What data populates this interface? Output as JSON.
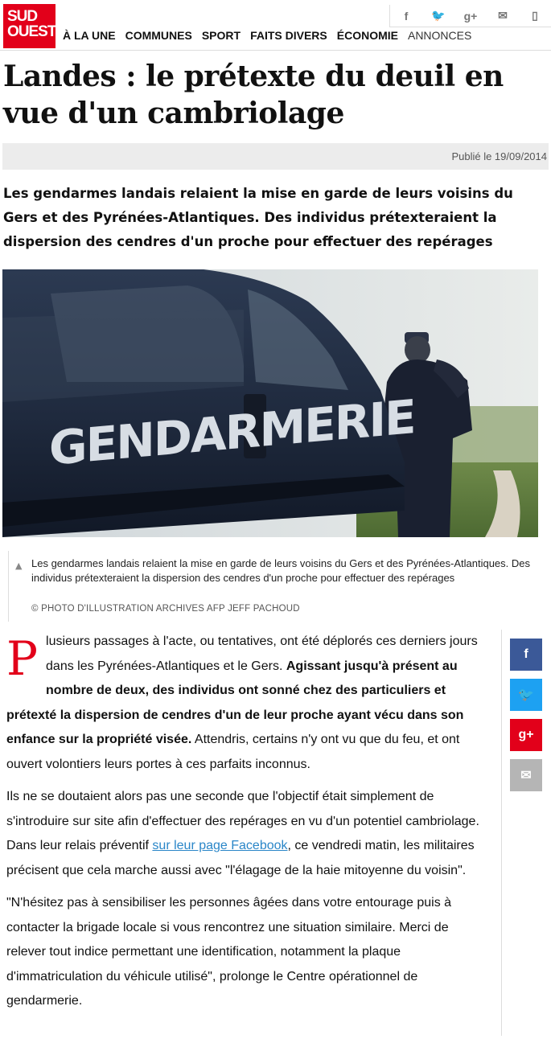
{
  "logo": {
    "line1": "SUD",
    "line2": "OUEST"
  },
  "share_top": [
    {
      "icon": "facebook-icon",
      "glyph": "f"
    },
    {
      "icon": "twitter-icon",
      "glyph": "🐦"
    },
    {
      "icon": "google-plus-icon",
      "glyph": "g+"
    },
    {
      "icon": "mail-icon",
      "glyph": "✉"
    },
    {
      "icon": "mobile-icon",
      "glyph": "▯"
    }
  ],
  "nav": [
    "À LA UNE",
    "COMMUNES",
    "SPORT",
    "FAITS DIVERS",
    "ÉCONOMIE",
    "ANNONCES"
  ],
  "article": {
    "title": "Landes : le prétexte du deuil en vue d'un cambriolage",
    "published": "Publié le 19/09/2014",
    "lead": "Les gendarmes landais relaient la mise en garde de leurs voisins du Gers et des Pyrénées-Atlantiques. Des individus prétexteraient la dispersion des cendres d'un proche pour effectuer des repérages",
    "photo_text": "GENDARMERIE",
    "caption": "Les gendarmes landais relaient la mise en garde de leurs voisins du Gers et des Pyrénées-Atlantiques. Des individus prétexteraient la dispersion des cendres d'un proche pour effectuer des repérages",
    "credit": "© PHOTO D'ILLUSTRATION ARCHIVES AFP JEFF PACHOUD",
    "p1_dropcap": "P",
    "p1_a": "lusieurs passages à l'acte, ou tentatives, ont été déplorés ces derniers jours dans les Pyrénées-Atlantiques et le Gers. ",
    "p1_bold": "Agissant jusqu'à présent au nombre de deux, des individus ont sonné chez des particuliers et prétexté la dispersion de cendres d'un de leur proche ayant vécu dans son enfance sur la propriété visée.",
    "p1_b": " Attendris, certains n'y ont vu que du feu, et ont ouvert volontiers leurs portes à ces parfaits inconnus.",
    "p2_a": "Ils ne se doutaient alors pas une seconde que l'objectif était simplement de s'introduire sur site afin d'effectuer des repérages en vu d'un potentiel cambriolage. Dans leur relais préventif ",
    "p2_link": "sur leur page Facebook",
    "p2_b": ", ce vendredi matin, les militaires précisent que cela marche aussi avec \"l'élagage de la haie mitoyenne du voisin\".",
    "p3": "\"N'hésitez pas à sensibiliser les personnes âgées dans votre entourage puis à contacter la brigade locale si vous rencontrez une situation similaire. Merci de relever tout indice permettant une identification, notamment la plaque d'immatriculation du véhicule utilisé\", prolonge le Centre opérationnel de gendarmerie."
  },
  "share_side": [
    {
      "icon": "facebook-icon",
      "glyph": "f",
      "color": "#3b5998"
    },
    {
      "icon": "twitter-icon",
      "glyph": "🐦",
      "color": "#1da1f2"
    },
    {
      "icon": "google-plus-icon",
      "glyph": "g+",
      "color": "#e2001a"
    },
    {
      "icon": "mail-icon",
      "glyph": "✉",
      "color": "#b5b5b5"
    }
  ],
  "colors": {
    "brand": "#e2001a",
    "link": "#2a86c8"
  }
}
